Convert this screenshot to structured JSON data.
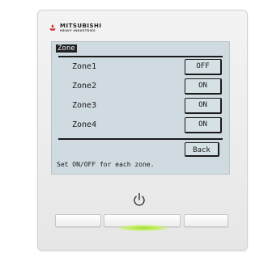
{
  "brand": {
    "name": "MITSUBISHI",
    "subtitle": "HEAVY INDUSTRIES"
  },
  "screen": {
    "title": "Zone",
    "zones": [
      {
        "label": "Zone1",
        "state": "OFF"
      },
      {
        "label": "Zone2",
        "state": "ON"
      },
      {
        "label": "Zone3",
        "state": "ON"
      },
      {
        "label": "Zone4",
        "state": "ON"
      }
    ],
    "back_label": "Back",
    "instruction": "Set ON/OFF for each zone."
  },
  "colors": {
    "lcd_background": "#cfdbe1",
    "led_green": "#9fe03a",
    "brand_red": "#d3242b"
  },
  "icons": {
    "brand_mark": "three-diamonds-icon",
    "power": "power-icon"
  },
  "status": {
    "led_on": true
  }
}
